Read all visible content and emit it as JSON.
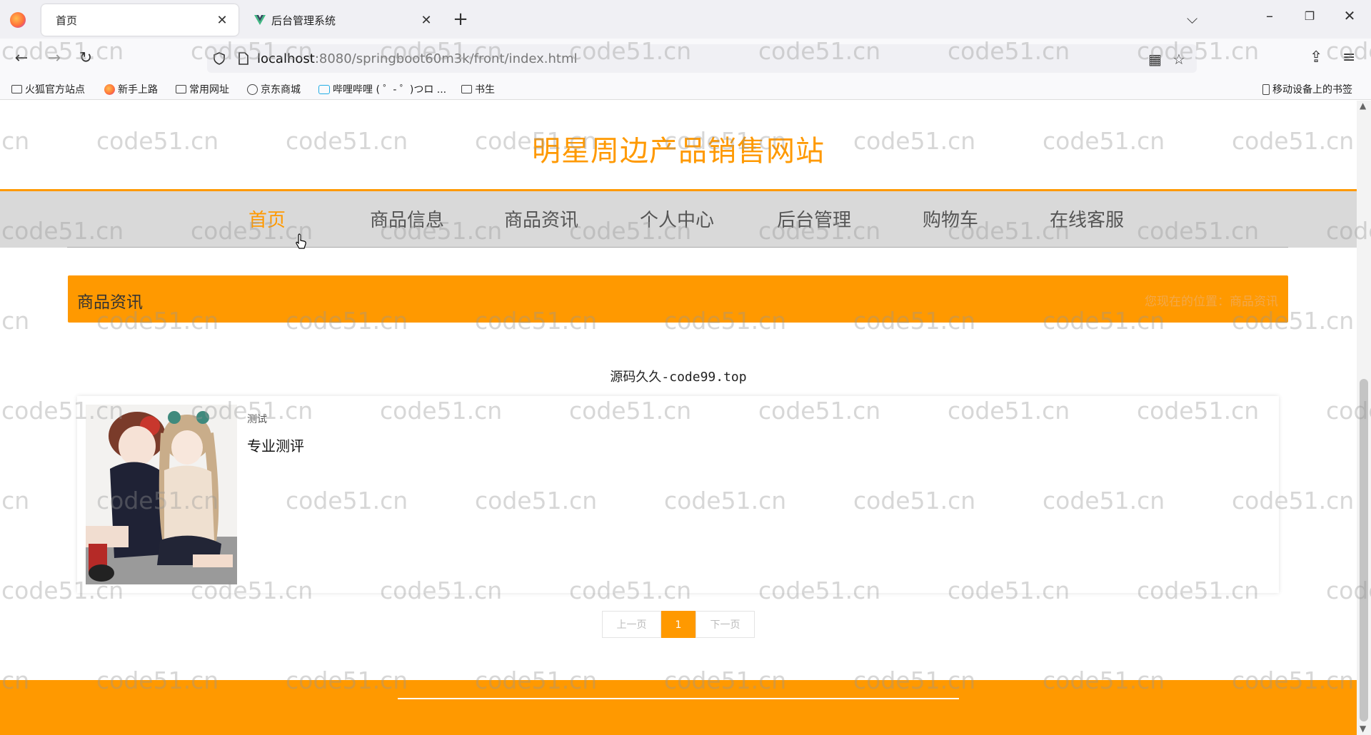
{
  "browser": {
    "tabs": [
      {
        "title": "首页",
        "active": true
      },
      {
        "title": "后台管理系统",
        "active": false
      }
    ],
    "url_host": "localhost",
    "url_path": ":8080/springboot60m3k/front/index.html",
    "bookmarks": [
      "火狐官方站点",
      "新手上路",
      "常用网址",
      "京东商城",
      "哔哩哔哩 ( ゜- ゜)つロ ...",
      "书生"
    ],
    "mobile_bookmarks": "移动设备上的书签"
  },
  "site": {
    "title": "明星周边产品销售网站",
    "menu": [
      "首页",
      "商品信息",
      "商品资讯",
      "个人中心",
      "后台管理",
      "购物车",
      "在线客服"
    ],
    "active_menu": "首页"
  },
  "section": {
    "title": "商品资讯",
    "breadcrumb": "您现在的位置：商品资讯"
  },
  "subtitle": "源码久久-code99.top",
  "news": [
    {
      "tag": "测试",
      "title": "专业测评"
    }
  ],
  "pagination": {
    "prev": "上一页",
    "current": "1",
    "next": "下一页"
  },
  "watermark": "code51.cn",
  "colors": {
    "accent": "#ff9900",
    "menu_bg": "#d9d9d9"
  }
}
